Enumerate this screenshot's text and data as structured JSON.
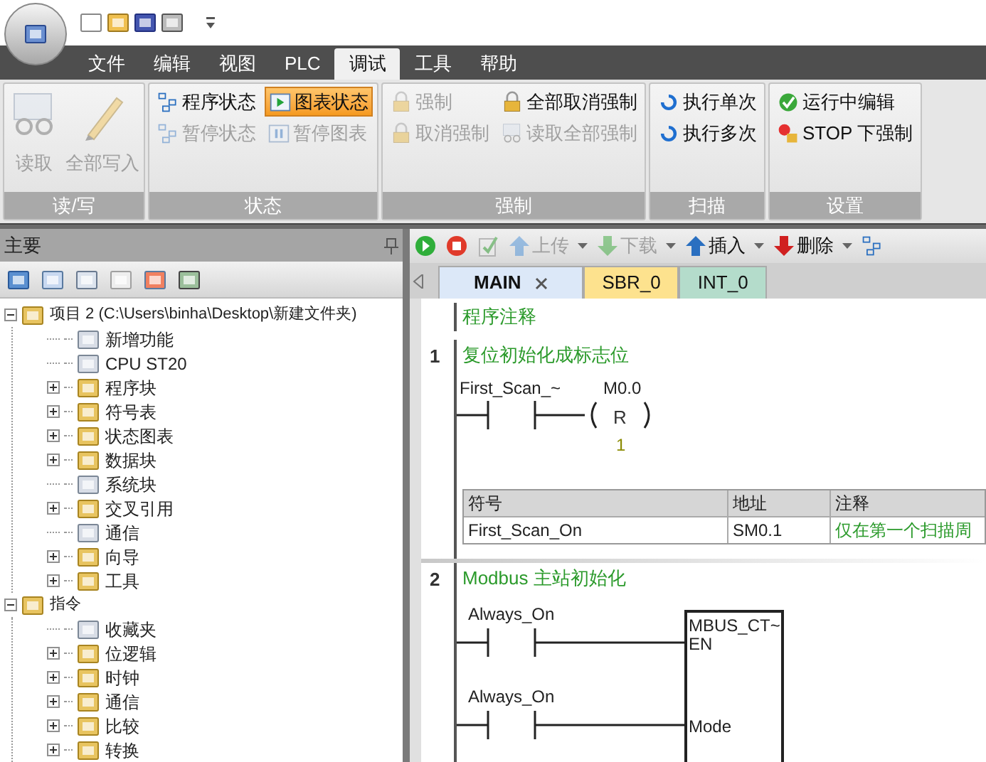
{
  "menu_tabs": [
    {
      "label": "文件",
      "selected": false
    },
    {
      "label": "编辑",
      "selected": false
    },
    {
      "label": "视图",
      "selected": false
    },
    {
      "label": "PLC",
      "selected": false
    },
    {
      "label": "调试",
      "selected": true
    },
    {
      "label": "工具",
      "selected": false
    },
    {
      "label": "帮助",
      "selected": false
    }
  ],
  "ribbon_groups": [
    {
      "label": "读/写",
      "buttons": [
        {
          "label": "读取",
          "kind": "large",
          "disabled": true,
          "pressed": false
        },
        {
          "label": "全部写入",
          "kind": "large",
          "disabled": true,
          "pressed": false
        }
      ]
    },
    {
      "label": "状态",
      "buttons": [
        {
          "label": "程序状态",
          "kind": "small",
          "disabled": false,
          "pressed": false
        },
        {
          "label": "暂停状态",
          "kind": "small",
          "disabled": true,
          "pressed": false
        },
        {
          "label": "图表状态",
          "kind": "small",
          "disabled": false,
          "pressed": true
        },
        {
          "label": "暂停图表",
          "kind": "small",
          "disabled": true,
          "pressed": false
        }
      ]
    },
    {
      "label": "强制",
      "buttons": [
        {
          "label": "强制",
          "kind": "small",
          "disabled": true,
          "pressed": false
        },
        {
          "label": "取消强制",
          "kind": "small",
          "disabled": true,
          "pressed": false
        },
        {
          "label": "全部取消强制",
          "kind": "small",
          "disabled": false,
          "pressed": false
        },
        {
          "label": "读取全部强制",
          "kind": "small",
          "disabled": true,
          "pressed": false
        }
      ]
    },
    {
      "label": "扫描",
      "buttons": [
        {
          "label": "执行单次",
          "kind": "small",
          "disabled": false,
          "pressed": false
        },
        {
          "label": "执行多次",
          "kind": "small",
          "disabled": false,
          "pressed": false
        }
      ]
    },
    {
      "label": "设置",
      "buttons": [
        {
          "label": "运行中编辑",
          "kind": "small",
          "disabled": false,
          "pressed": false
        },
        {
          "label": "STOP 下强制",
          "kind": "small",
          "disabled": false,
          "pressed": false
        }
      ]
    }
  ],
  "left_panel": {
    "title": "主要",
    "tree": [
      {
        "label": "项目 2 (C:\\Users\\binha\\Desktop\\新建文件夹)",
        "expanded": true,
        "children": [
          {
            "label": "新增功能"
          },
          {
            "label": "CPU ST20"
          },
          {
            "label": "程序块",
            "expanded": false
          },
          {
            "label": "符号表",
            "expanded": false
          },
          {
            "label": "状态图表",
            "expanded": false
          },
          {
            "label": "数据块",
            "expanded": false
          },
          {
            "label": "系统块"
          },
          {
            "label": "交叉引用",
            "expanded": false
          },
          {
            "label": "通信"
          },
          {
            "label": "向导",
            "expanded": false
          },
          {
            "label": "工具",
            "expanded": false
          }
        ]
      },
      {
        "label": "指令",
        "expanded": true,
        "children": [
          {
            "label": "收藏夹"
          },
          {
            "label": "位逻辑",
            "expanded": false
          },
          {
            "label": "时钟",
            "expanded": false
          },
          {
            "label": "通信",
            "expanded": false
          },
          {
            "label": "比较",
            "expanded": false
          },
          {
            "label": "转换",
            "expanded": false
          }
        ]
      }
    ]
  },
  "editor_toolbar": [
    {
      "label": "上传",
      "disabled": true
    },
    {
      "label": "下载",
      "disabled": true
    },
    {
      "label": "插入",
      "disabled": false
    },
    {
      "label": "删除",
      "disabled": false
    }
  ],
  "editor_tabs": [
    {
      "label": "MAIN",
      "selected": true,
      "color": "#dce8f8"
    },
    {
      "label": "SBR_0",
      "selected": false,
      "color": "#fde28e"
    },
    {
      "label": "INT_0",
      "selected": false,
      "color": "#b4dccb"
    }
  ],
  "program_comment": "程序注释",
  "networks": [
    {
      "number": "1",
      "comment": "复位初始化成标志位",
      "kind": "coil",
      "contact": "First_Scan_~",
      "coil_address": "M0.0",
      "coil_op": "R",
      "coil_count": "1",
      "symbol_table": {
        "columns": [
          "符号",
          "地址",
          "注释"
        ],
        "rows": [
          [
            "First_Scan_On",
            "SM0.1",
            "仅在第一个扫描周"
          ]
        ]
      }
    },
    {
      "number": "2",
      "comment": "Modbus 主站初始化",
      "kind": "box",
      "contacts": [
        "Always_On",
        "Always_On"
      ],
      "box_title": "MBUS_CT~",
      "pins": [
        "EN",
        "Mode"
      ]
    }
  ]
}
